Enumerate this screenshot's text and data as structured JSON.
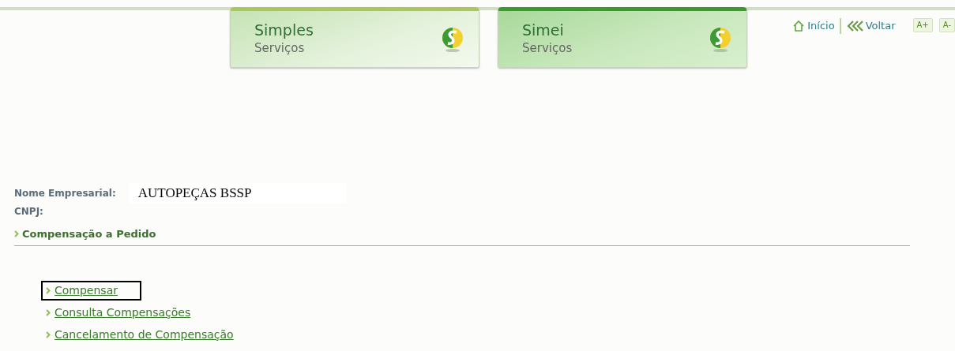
{
  "banners": [
    {
      "title": "Simples",
      "subtitle": "Serviços",
      "selected": false
    },
    {
      "title": "Simei",
      "subtitle": "Serviços",
      "selected": true
    }
  ],
  "top_links": [
    {
      "label": "Início",
      "kind": "home"
    },
    {
      "label": "Voltar",
      "kind": "back"
    }
  ],
  "font_buttons": [
    "A+",
    "A-"
  ],
  "company": {
    "name_label": "Nome Empresarial:",
    "name_value": "AUTOPEÇAS BSSP",
    "cnpj_label": "CNPJ:"
  },
  "section_title": "Compensação a Pedido",
  "links": [
    {
      "label": "Compensar",
      "focused": true
    },
    {
      "label": "Consulta Compensações",
      "focused": false
    },
    {
      "label": "Cancelamento de Compensação",
      "focused": false
    }
  ]
}
